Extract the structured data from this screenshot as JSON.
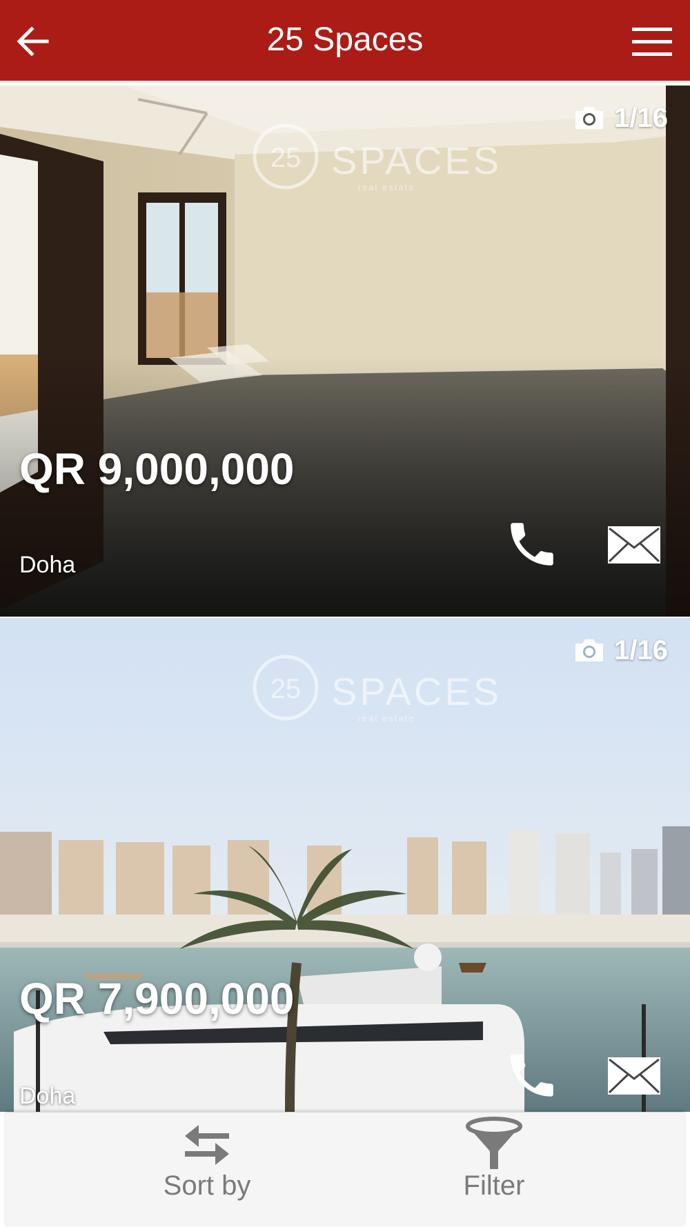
{
  "header": {
    "title": "25 Spaces",
    "back_icon": "arrow-left-icon",
    "menu_icon": "hamburger-menu-icon",
    "background_color": "#ab1c16"
  },
  "listings": [
    {
      "photo_counter": "1/16",
      "price": "QR 9,000,000",
      "location": "Doha",
      "watermark_text": "SPACES",
      "watermark_sub": "real estate",
      "watermark_num": "25"
    },
    {
      "photo_counter": "1/16",
      "price": "QR 7,900,000",
      "location": "Doha",
      "watermark_text": "SPACES",
      "watermark_sub": "real estate",
      "watermark_num": "25"
    }
  ],
  "bottom_bar": {
    "sort_label": "Sort by",
    "filter_label": "Filter",
    "sort_icon": "sort-arrows-icon",
    "filter_icon": "funnel-icon"
  },
  "colors": {
    "accent": "#ab1c16",
    "tab_text": "#7a7a7a",
    "bar_bg": "#f5f5f5"
  }
}
